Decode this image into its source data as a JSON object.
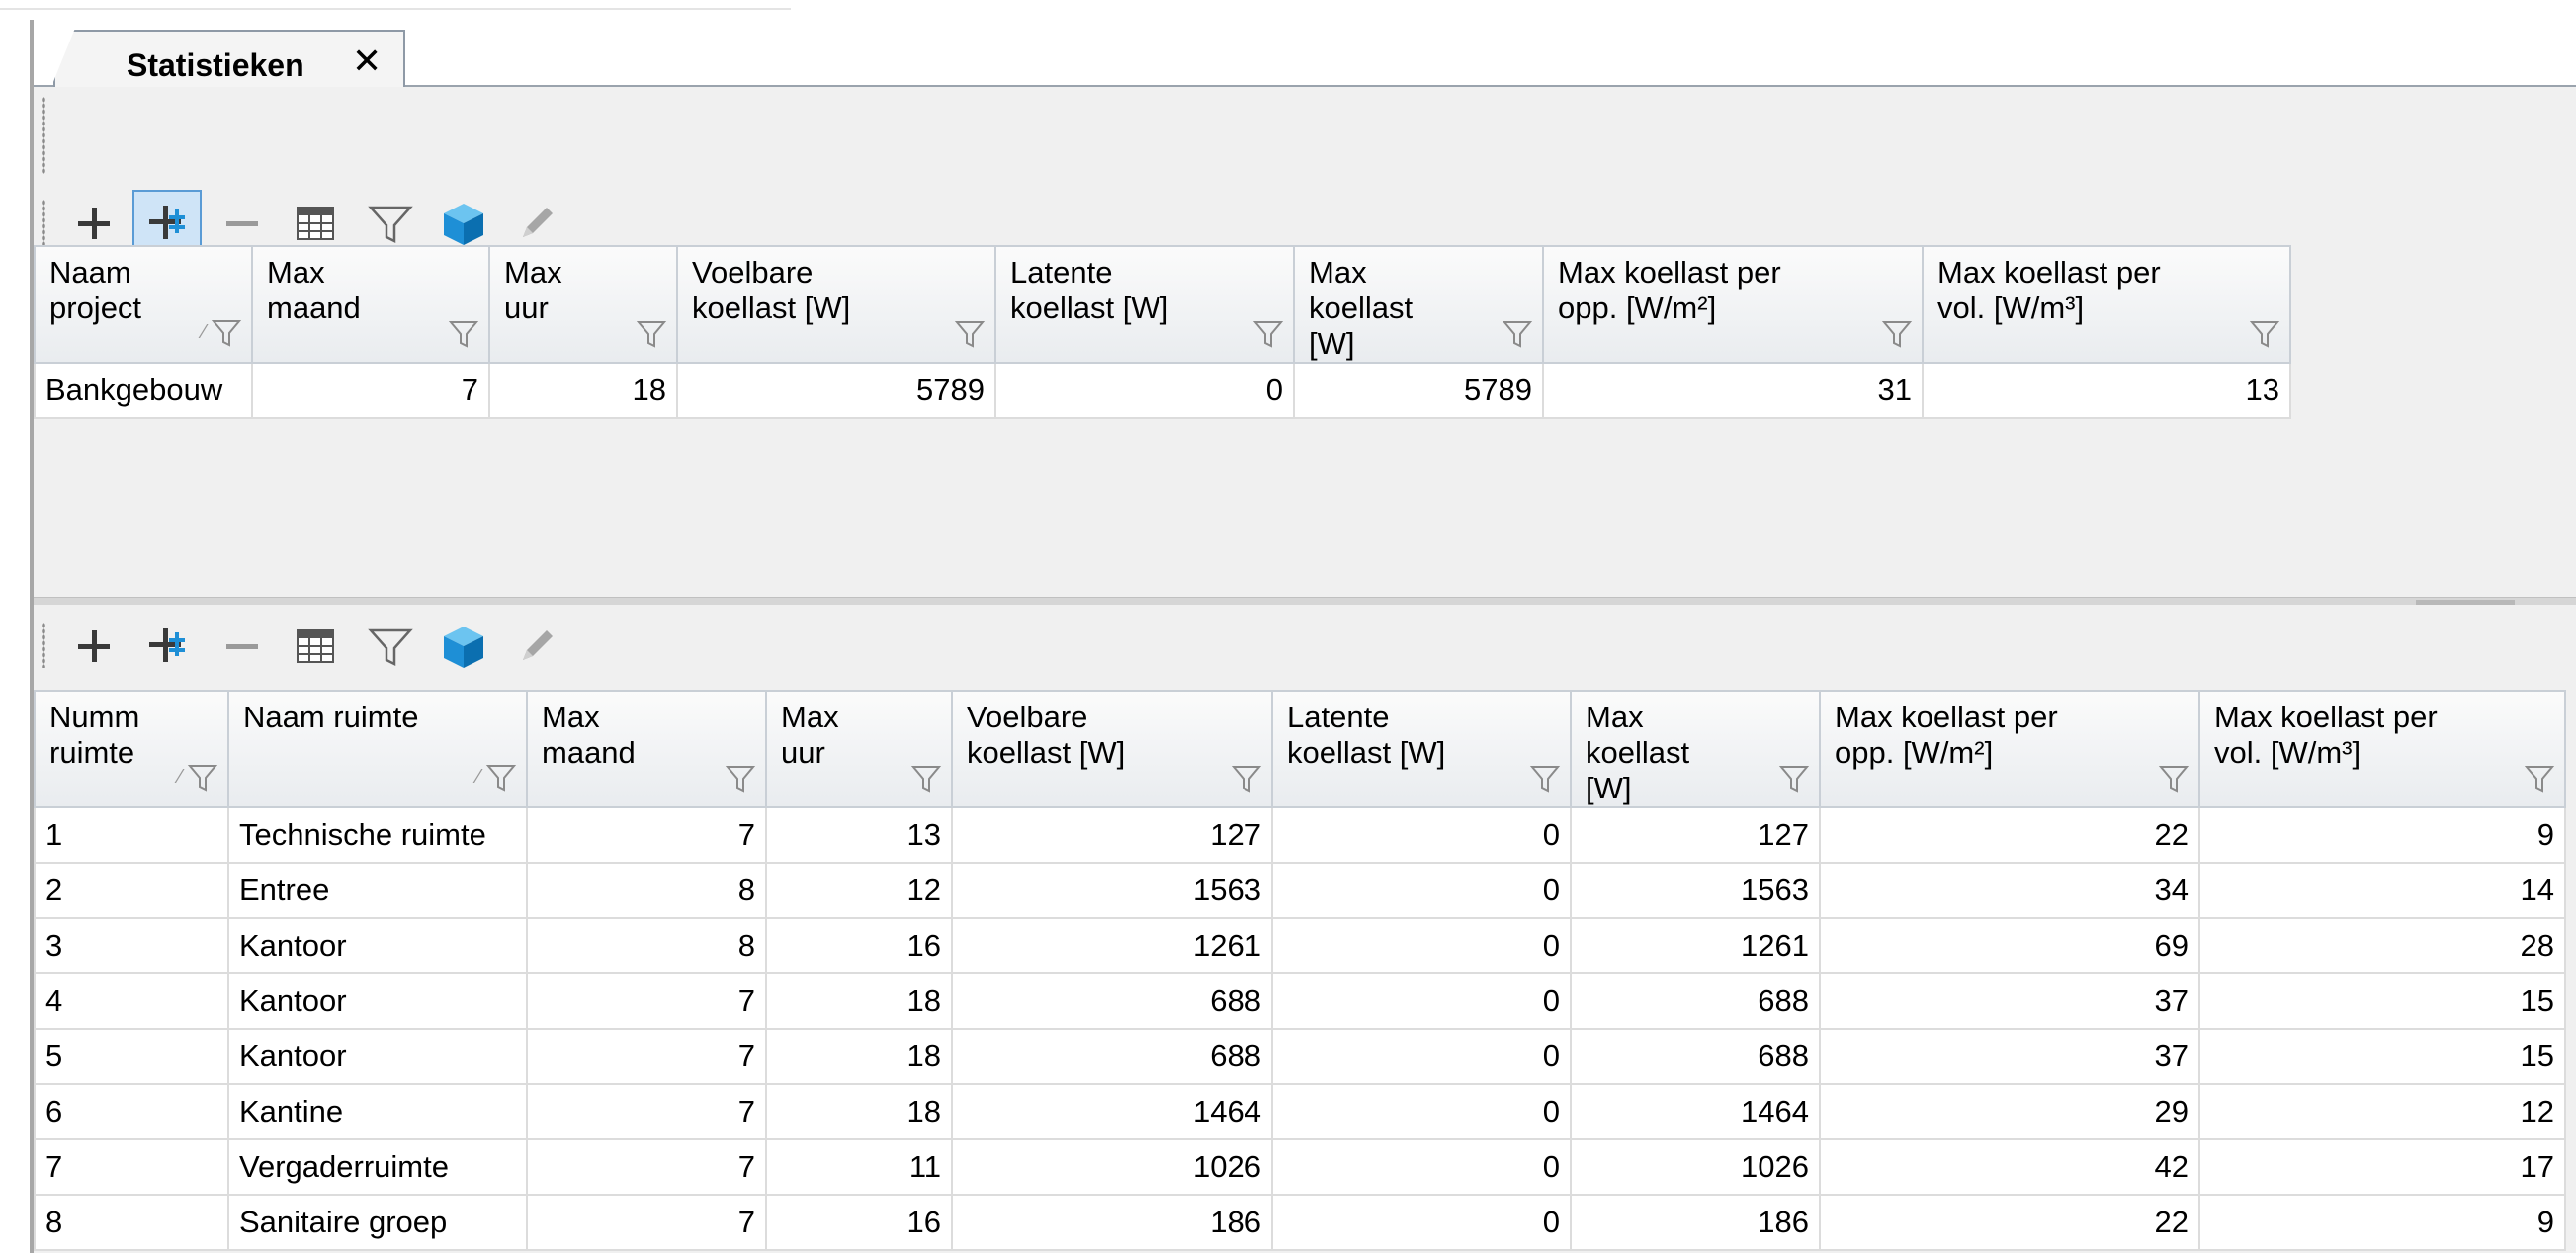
{
  "tab": {
    "title": "Statistieken",
    "close_glyph": "✕"
  },
  "toolbar_icons": [
    "plus-icon",
    "add-child-icon",
    "minus-icon",
    "table-icon",
    "filter-icon",
    "cube-icon",
    "pencil-icon"
  ],
  "project_grid": {
    "columns": [
      {
        "label": "Naam project",
        "sorted": true
      },
      {
        "label": "Max maand"
      },
      {
        "label": "Max uur"
      },
      {
        "label": "Voelbare koellast [W]"
      },
      {
        "label": "Latente koellast [W]"
      },
      {
        "label": "Max koellast [W]"
      },
      {
        "label": "Max koellast per opp. [W/m²]"
      },
      {
        "label": "Max koellast per vol. [W/m³]"
      }
    ],
    "rows": [
      [
        "Bankgebouw",
        "7",
        "18",
        "5789",
        "0",
        "5789",
        "31",
        "13"
      ]
    ]
  },
  "room_grid": {
    "columns": [
      {
        "label": "Numm ruimte",
        "sorted": true
      },
      {
        "label": "Naam ruimte",
        "sorted": true
      },
      {
        "label": "Max maand"
      },
      {
        "label": "Max uur"
      },
      {
        "label": "Voelbare koellast [W]"
      },
      {
        "label": "Latente koellast [W]"
      },
      {
        "label": "Max koellast [W]"
      },
      {
        "label": "Max koellast per opp. [W/m²]"
      },
      {
        "label": "Max koellast per vol. [W/m³]"
      }
    ],
    "rows": [
      [
        "1",
        "Technische ruimte",
        "7",
        "13",
        "127",
        "0",
        "127",
        "22",
        "9"
      ],
      [
        "2",
        "Entree",
        "8",
        "12",
        "1563",
        "0",
        "1563",
        "34",
        "14"
      ],
      [
        "3",
        "Kantoor",
        "8",
        "16",
        "1261",
        "0",
        "1261",
        "69",
        "28"
      ],
      [
        "4",
        "Kantoor",
        "7",
        "18",
        "688",
        "0",
        "688",
        "37",
        "15"
      ],
      [
        "5",
        "Kantoor",
        "7",
        "18",
        "688",
        "0",
        "688",
        "37",
        "15"
      ],
      [
        "6",
        "Kantine",
        "7",
        "18",
        "1464",
        "0",
        "1464",
        "29",
        "12"
      ],
      [
        "7",
        "Vergaderruimte",
        "7",
        "11",
        "1026",
        "0",
        "1026",
        "42",
        "17"
      ],
      [
        "8",
        "Sanitaire groep",
        "7",
        "16",
        "186",
        "0",
        "186",
        "22",
        "9"
      ]
    ]
  },
  "colors": {
    "accent_blue": "#1e8fd6",
    "header_border": "#c9cfd6",
    "active_button": "#cfe4f7"
  }
}
